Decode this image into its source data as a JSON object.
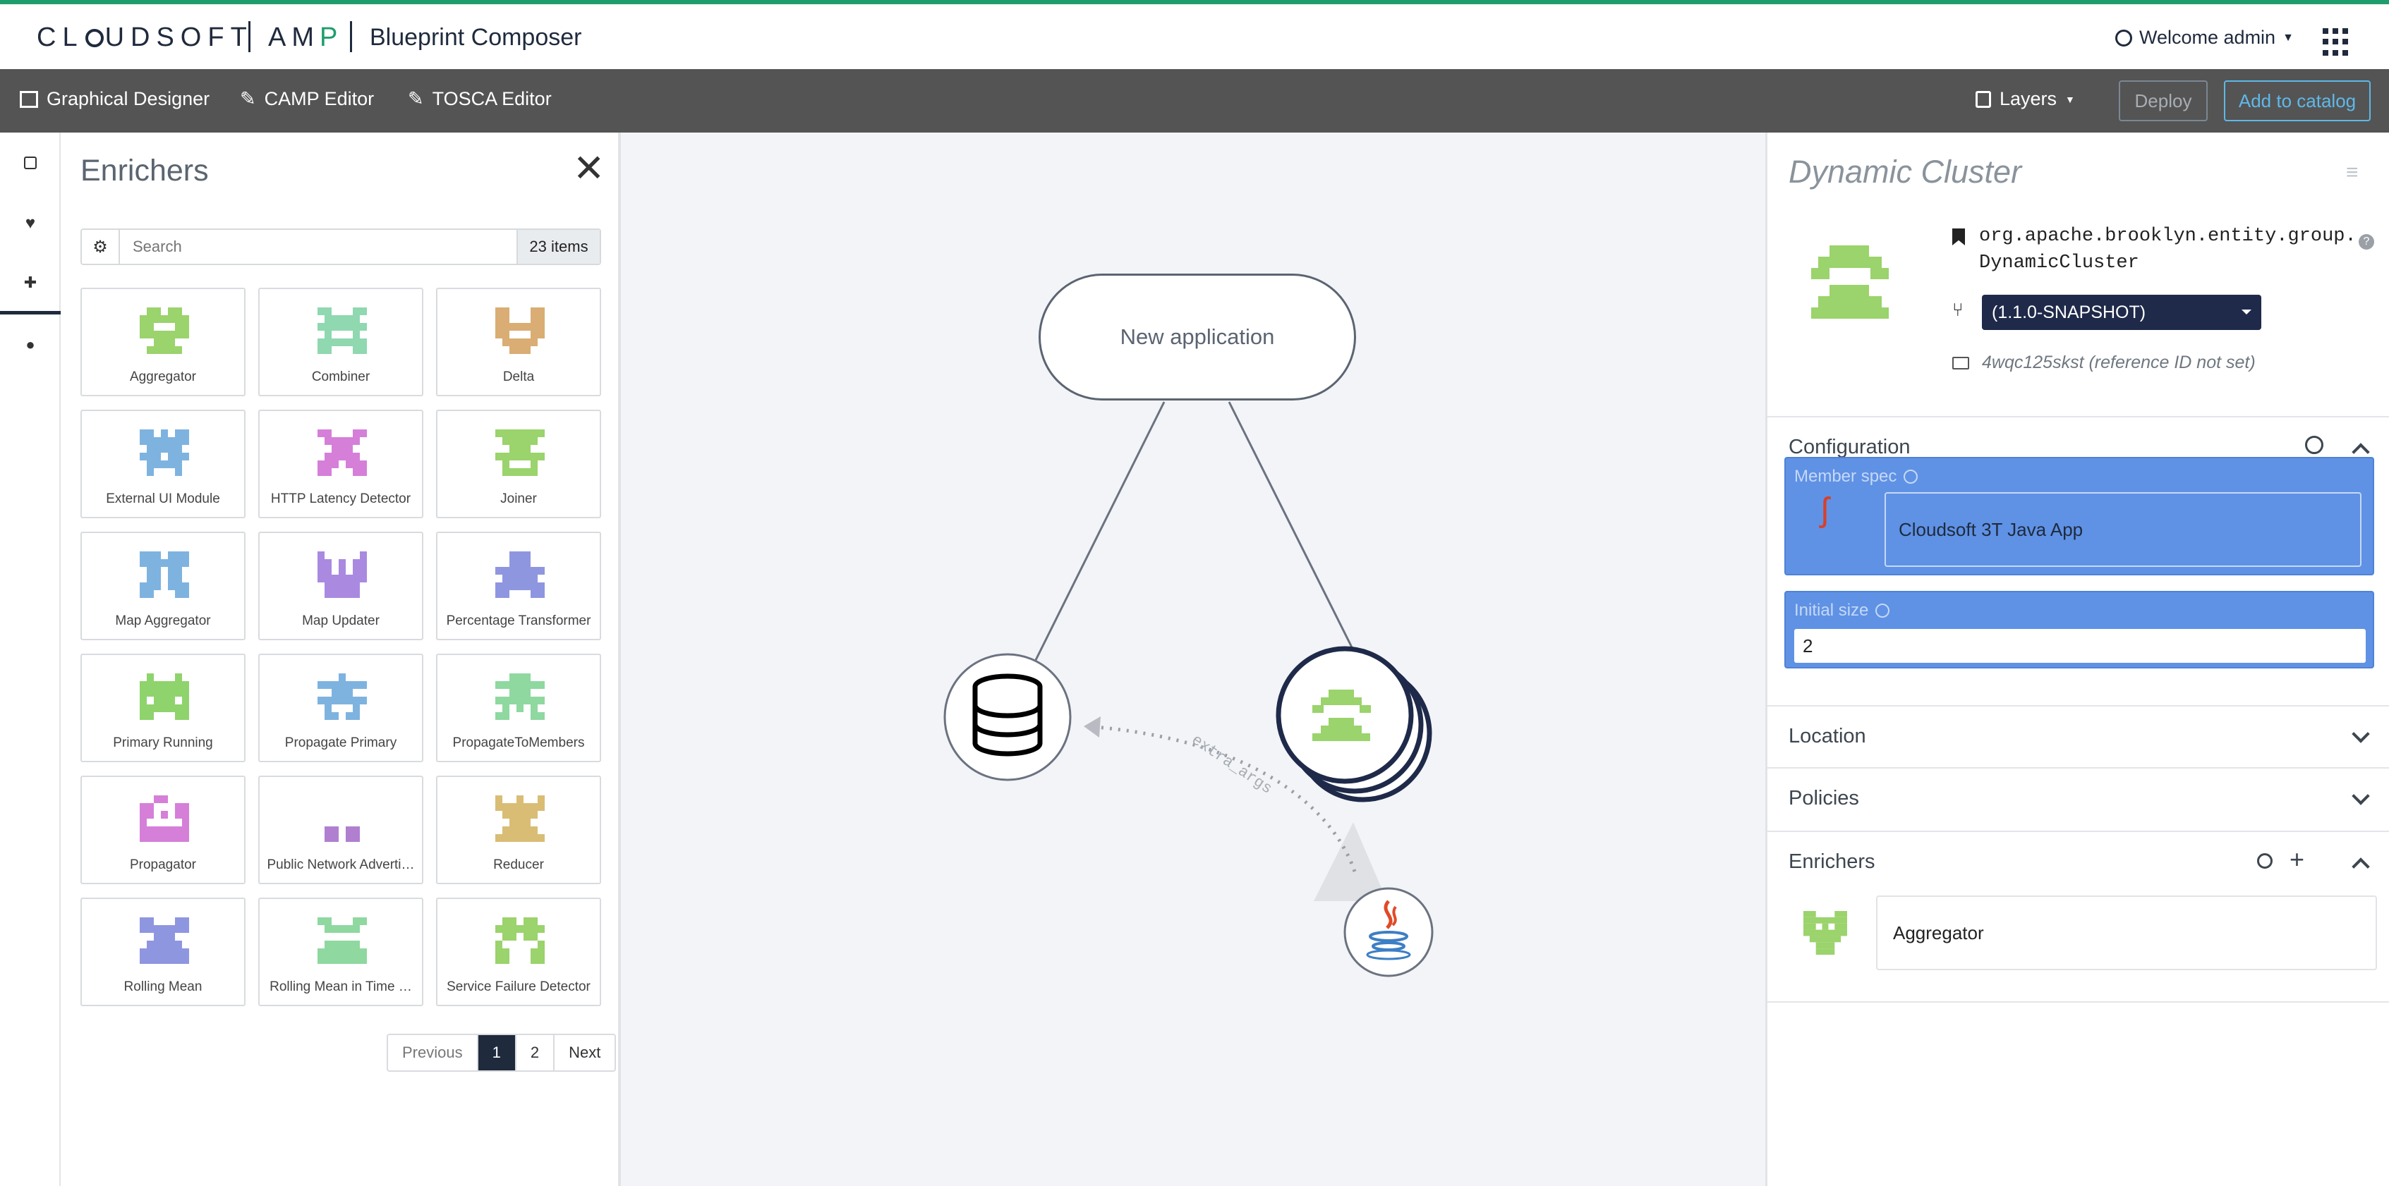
{
  "header": {
    "brand": "CL🞉UDSOFT",
    "product": "AMP",
    "app_title": "Blueprint Composer",
    "welcome": "Welcome admin"
  },
  "toolbar": {
    "graphical": "Graphical Designer",
    "camp": "CAMP Editor",
    "tosca": "TOSCA Editor",
    "layers": "Layers",
    "deploy": "Deploy",
    "add_catalog": "Add to catalog"
  },
  "panel": {
    "title": "Enrichers",
    "search_placeholder": "Search",
    "count": "23 items",
    "items": [
      {
        "label": "Aggregator",
        "color": "#9bd36c",
        "icon": "aggregator-icon"
      },
      {
        "label": "Combiner",
        "color": "#8fd8b0",
        "icon": "combiner-icon"
      },
      {
        "label": "Delta",
        "color": "#d9ad74",
        "icon": "delta-icon"
      },
      {
        "label": "External UI Module",
        "color": "#7eb3e0",
        "icon": "external-ui-module-icon"
      },
      {
        "label": "HTTP Latency Detector",
        "color": "#d57fd9",
        "icon": "http-latency-detector-icon"
      },
      {
        "label": "Joiner",
        "color": "#9bd36c",
        "icon": "joiner-icon"
      },
      {
        "label": "Map Aggregator",
        "color": "#7eb3e0",
        "icon": "map-aggregator-icon"
      },
      {
        "label": "Map Updater",
        "color": "#a98ae0",
        "icon": "map-updater-icon"
      },
      {
        "label": "Percentage Transformer",
        "color": "#8f96e0",
        "icon": "percentage-transformer-icon"
      },
      {
        "label": "Primary Running",
        "color": "#8fd36c",
        "icon": "primary-running-icon"
      },
      {
        "label": "Propagate Primary",
        "color": "#7eb3e0",
        "icon": "propagate-primary-icon"
      },
      {
        "label": "PropagateToMembers",
        "color": "#8fd8a0",
        "icon": "propagate-to-members-icon"
      },
      {
        "label": "Propagator",
        "color": "#d57fd9",
        "icon": "propagator-icon"
      },
      {
        "label": "Public Network Adverti…",
        "color": "#b07fd0",
        "icon": "public-network-advertiser-icon"
      },
      {
        "label": "Reducer",
        "color": "#d9bd74",
        "icon": "reducer-icon"
      },
      {
        "label": "Rolling Mean",
        "color": "#8f96e0",
        "icon": "rolling-mean-icon"
      },
      {
        "label": "Rolling Mean in Time …",
        "color": "#8fd8a0",
        "icon": "rolling-mean-in-time-icon"
      },
      {
        "label": "Service Failure Detector",
        "color": "#9bd36c",
        "icon": "service-failure-detector-icon"
      }
    ],
    "pager": {
      "prev": "Previous",
      "p1": "1",
      "p2": "2",
      "next": "Next"
    }
  },
  "canvas": {
    "app_label": "New application",
    "link_label": "extra_args"
  },
  "detail": {
    "title": "Dynamic Cluster",
    "type_line1": "org.apache.brooklyn.entity.group.",
    "type_line2": "DynamicCluster",
    "version": "(1.1.0-SNAPSHOT)",
    "ref_id": "4wqc125skst (reference ID not set)",
    "configuration": "Configuration",
    "member_spec_label": "Member spec",
    "member_spec_value": "Cloudsoft 3T Java App",
    "initial_size_label": "Initial size",
    "initial_size_value": "2",
    "location": "Location",
    "policies": "Policies",
    "enrichers": "Enrichers",
    "enricher_item": "Aggregator"
  }
}
